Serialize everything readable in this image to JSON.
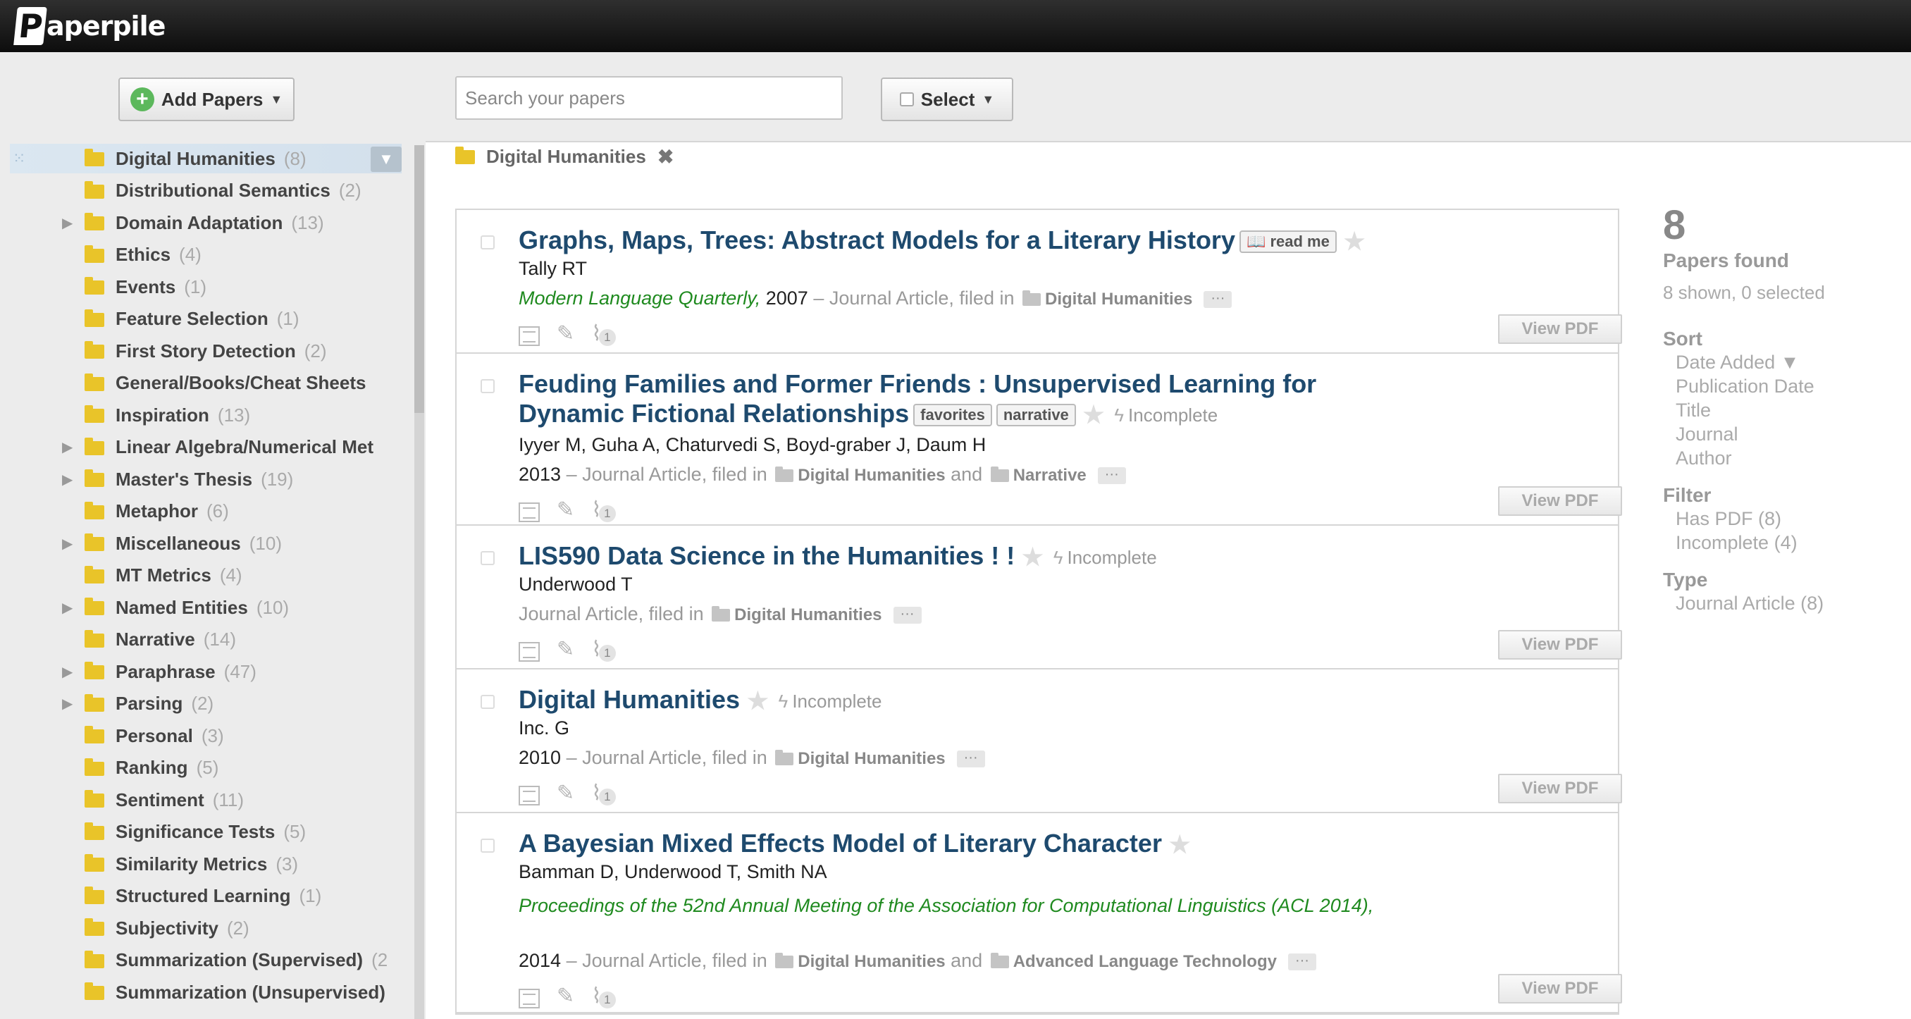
{
  "app": {
    "logo_text": "aperpile",
    "logo_letter": "P"
  },
  "toolbar": {
    "add_papers_label": "Add Papers",
    "search_placeholder": "Search your papers",
    "select_label": "Select"
  },
  "sidebar": {
    "folders": [
      {
        "label": "Digital Humanities",
        "count": "(8)",
        "expandable": false,
        "selected": true
      },
      {
        "label": "Distributional Semantics",
        "count": "(2)",
        "expandable": false
      },
      {
        "label": "Domain Adaptation",
        "count": "(13)",
        "expandable": true
      },
      {
        "label": "Ethics",
        "count": "(4)",
        "expandable": false
      },
      {
        "label": "Events",
        "count": "(1)",
        "expandable": false
      },
      {
        "label": "Feature Selection",
        "count": "(1)",
        "expandable": false
      },
      {
        "label": "First Story Detection",
        "count": "(2)",
        "expandable": false
      },
      {
        "label": "General/Books/Cheat Sheets",
        "count": "",
        "expandable": false
      },
      {
        "label": "Inspiration",
        "count": "(13)",
        "expandable": false
      },
      {
        "label": "Linear Algebra/Numerical Met",
        "count": "",
        "expandable": true
      },
      {
        "label": "Master's Thesis",
        "count": "(19)",
        "expandable": true
      },
      {
        "label": "Metaphor",
        "count": "(6)",
        "expandable": false
      },
      {
        "label": "Miscellaneous",
        "count": "(10)",
        "expandable": true
      },
      {
        "label": "MT Metrics",
        "count": "(4)",
        "expandable": false
      },
      {
        "label": "Named Entities",
        "count": "(10)",
        "expandable": true
      },
      {
        "label": "Narrative",
        "count": "(14)",
        "expandable": false
      },
      {
        "label": "Paraphrase",
        "count": "(47)",
        "expandable": true
      },
      {
        "label": "Parsing",
        "count": "(2)",
        "expandable": true
      },
      {
        "label": "Personal",
        "count": "(3)",
        "expandable": false
      },
      {
        "label": "Ranking",
        "count": "(5)",
        "expandable": false
      },
      {
        "label": "Sentiment",
        "count": "(11)",
        "expandable": false
      },
      {
        "label": "Significance Tests",
        "count": "(5)",
        "expandable": false
      },
      {
        "label": "Similarity Metrics",
        "count": "(3)",
        "expandable": false
      },
      {
        "label": "Structured Learning",
        "count": "(1)",
        "expandable": false
      },
      {
        "label": "Subjectivity",
        "count": "(2)",
        "expandable": false
      },
      {
        "label": "Summarization (Supervised)",
        "count": "(2",
        "expandable": false
      },
      {
        "label": "Summarization (Unsupervised)",
        "count": "",
        "expandable": false
      }
    ]
  },
  "breadcrumb": {
    "label": "Digital Humanities",
    "close": "✖"
  },
  "papers": [
    {
      "title": "Graphs, Maps, Trees: Abstract Models for a Literary History",
      "tags": [
        "📖 read me"
      ],
      "incomplete": "",
      "authors": "Tally RT",
      "journal": "Modern Language Quarterly,",
      "year": "2007",
      "type_text": "– Journal Article, filed in",
      "folders": [
        "Digital Humanities"
      ],
      "attachments": "1",
      "pdf_label": "View PDF"
    },
    {
      "title": "Feuding Families and Former Friends : Unsupervised Learning for Dynamic Fictional Relationships",
      "tags": [
        "favorites",
        "narrative"
      ],
      "incomplete": "Incomplete",
      "authors": "Iyyer M, Guha A, Chaturvedi S, Boyd-graber J, Daum H",
      "journal": "",
      "year": "2013",
      "type_text": "– Journal Article, filed in",
      "folders": [
        "Digital Humanities",
        "Narrative"
      ],
      "attachments": "1",
      "pdf_label": "View PDF"
    },
    {
      "title": "LIS590 Data Science in the Humanities ! !",
      "tags": [],
      "incomplete": "Incomplete",
      "authors": "Underwood T",
      "journal": "",
      "year": "",
      "type_text": "Journal Article, filed in",
      "folders": [
        "Digital Humanities"
      ],
      "attachments": "1",
      "pdf_label": "View PDF"
    },
    {
      "title": "Digital Humanities",
      "tags": [],
      "incomplete": "Incomplete",
      "authors": "Inc. G",
      "journal": "",
      "year": "2010",
      "type_text": "– Journal Article, filed in",
      "folders": [
        "Digital Humanities"
      ],
      "attachments": "1",
      "pdf_label": "View PDF"
    },
    {
      "title": "A Bayesian Mixed Effects Model of Literary Character",
      "tags": [],
      "incomplete": "",
      "authors": "Bamman D, Underwood T, Smith NA",
      "journal": "Proceedings of the 52nd Annual Meeting of the Association for Computational Linguistics (ACL 2014),",
      "year": "2014",
      "type_text": "– Journal Article, filed in",
      "folders": [
        "Digital Humanities",
        "Advanced Language Technology"
      ],
      "attachments": "1",
      "pdf_label": "View PDF"
    }
  ],
  "filed_joiner": "and",
  "more_label": "···",
  "right_panel": {
    "count": "8",
    "found_label": "Papers found",
    "shown_label": "8 shown, 0 selected",
    "sort_label": "Sort",
    "sort_options": [
      "Date Added ▼",
      "Publication Date",
      "Title",
      "Journal",
      "Author"
    ],
    "filter_label": "Filter",
    "filter_options": [
      "Has PDF (8)",
      "Incomplete (4)"
    ],
    "type_label": "Type",
    "type_options": [
      "Journal Article (8)"
    ]
  },
  "colors": {
    "title": "#1e4a6e",
    "journal": "#1f8a1f",
    "folder": "#e9c429",
    "selected_row": "#dbe7f1"
  }
}
